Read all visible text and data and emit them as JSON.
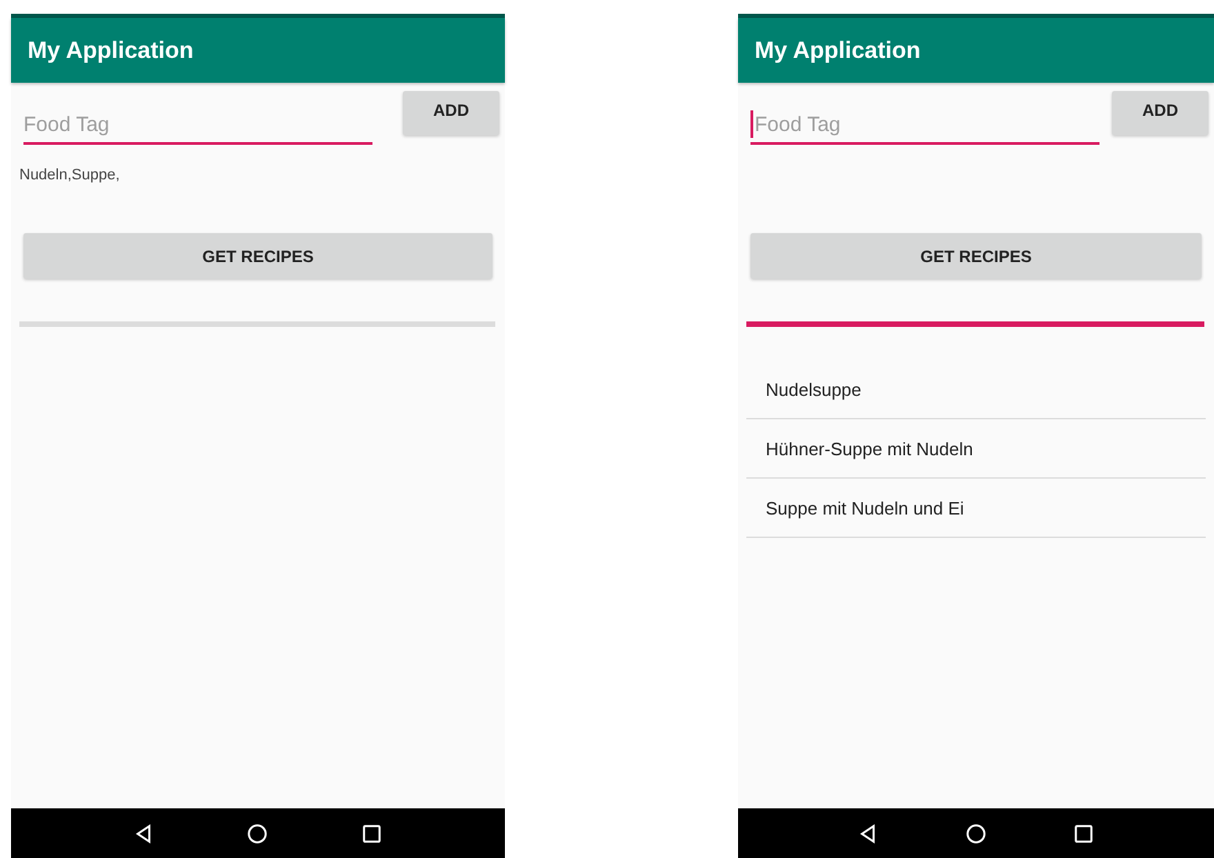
{
  "screens": [
    {
      "app_bar": {
        "title": "My Application"
      },
      "food_tag_field": {
        "placeholder": "Food Tag",
        "focused": false
      },
      "add_button": "ADD",
      "tags_text": "Nudeln,Suppe,",
      "get_recipes_button": "GET RECIPES",
      "progress": {
        "level": 0
      }
    },
    {
      "app_bar": {
        "title": "My Application"
      },
      "food_tag_field": {
        "placeholder": "Food Tag",
        "focused": true
      },
      "add_button": "ADD",
      "get_recipes_button": "GET RECIPES",
      "progress": {
        "level": 1
      },
      "recipes": [
        {
          "name": "Nudelsuppe"
        },
        {
          "name": "Hühner-Suppe mit Nudeln"
        },
        {
          "name": "Suppe mit Nudeln und Ei"
        }
      ]
    }
  ]
}
